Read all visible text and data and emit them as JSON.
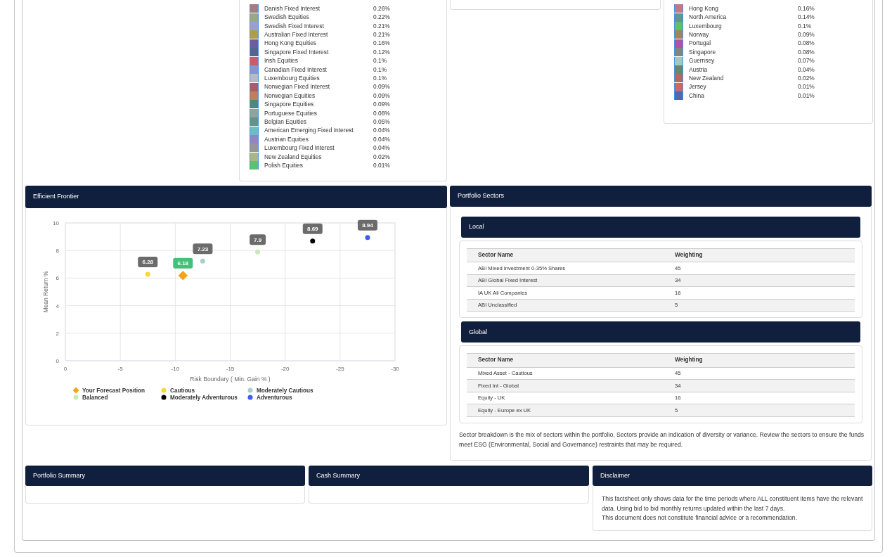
{
  "asset_classes": {
    "items": [
      {
        "name": "Danish Fixed Interest",
        "value": "0.26%",
        "color": "#a67c80"
      },
      {
        "name": "Swedish Equities",
        "value": "0.22%",
        "color": "#9aa882"
      },
      {
        "name": "Swedish Fixed Interest",
        "value": "0.21%",
        "color": "#9b9fd0"
      },
      {
        "name": "Australian Fixed Interest",
        "value": "0.21%",
        "color": "#b59a4e"
      },
      {
        "name": "Hong Kong Equities",
        "value": "0.16%",
        "color": "#6e5c9e"
      },
      {
        "name": "Singapore Fixed Interest",
        "value": "0.12%",
        "color": "#56648f"
      },
      {
        "name": "Irish Equities",
        "value": "0.1%",
        "color": "#cc5d63"
      },
      {
        "name": "Canadian Fixed Interest",
        "value": "0.1%",
        "color": "#8396cf"
      },
      {
        "name": "Luxembourg Equities",
        "value": "0.1%",
        "color": "#b6bdb8"
      },
      {
        "name": "Norwegian Fixed Interest",
        "value": "0.09%",
        "color": "#a85d6a"
      },
      {
        "name": "Norwegian Equities",
        "value": "0.09%",
        "color": "#c27d5a"
      },
      {
        "name": "Singapore Equities",
        "value": "0.09%",
        "color": "#4e8879"
      },
      {
        "name": "Portuguese Equities",
        "value": "0.08%",
        "color": "#8fa595"
      },
      {
        "name": "Belgian Equities",
        "value": "0.05%",
        "color": "#659484"
      },
      {
        "name": "American Emerging Fixed Interest",
        "value": "0.04%",
        "color": "#6cbec2"
      },
      {
        "name": "Austrian Equities",
        "value": "0.04%",
        "color": "#9683c4"
      },
      {
        "name": "Luxembourg Fixed Interest",
        "value": "0.04%",
        "color": "#9b9494"
      },
      {
        "name": "New Zealand Equities",
        "value": "0.02%",
        "color": "#a9b687"
      },
      {
        "name": "Polish Equities",
        "value": "0.01%",
        "color": "#5bc26f"
      }
    ]
  },
  "regions": {
    "items": [
      {
        "name": "Hong Kong",
        "value": "0.16%",
        "color": "#c27889"
      },
      {
        "name": "North America",
        "value": "0.14%",
        "color": "#5f9690"
      },
      {
        "name": "Luxembourg",
        "value": "0.1%",
        "color": "#63be6a"
      },
      {
        "name": "Norway",
        "value": "0.09%",
        "color": "#a0845a"
      },
      {
        "name": "Portugal",
        "value": "0.08%",
        "color": "#b052a8"
      },
      {
        "name": "Singapore",
        "value": "0.08%",
        "color": "#838480"
      },
      {
        "name": "Guernsey",
        "value": "0.07%",
        "color": "#a3c9bf"
      },
      {
        "name": "Austria",
        "value": "0.04%",
        "color": "#69876a"
      },
      {
        "name": "New Zealand",
        "value": "0.02%",
        "color": "#b06b5e"
      },
      {
        "name": "Jersey",
        "value": "0.01%",
        "color": "#cf6861"
      },
      {
        "name": "China",
        "value": "0.01%",
        "color": "#4f68b5"
      }
    ]
  },
  "efficient_frontier": {
    "title": "Efficient Frontier",
    "chart_data": {
      "type": "scatter",
      "xlabel": "Risk Boundary ( Min. Gain % )",
      "ylabel": "Mean Return %",
      "xlim": [
        0,
        -30
      ],
      "ylim": [
        0,
        10
      ],
      "xticks": [
        0,
        -5,
        -10,
        -15,
        -20,
        -25,
        -30
      ],
      "yticks": [
        0,
        2,
        4,
        6,
        8,
        10
      ],
      "data_labels": true,
      "grid": true,
      "legend": "bottom",
      "series": [
        {
          "name": "Your Forecast Position",
          "color": "#f7a21b",
          "marker": "diamond",
          "x": [
            -10.7
          ],
          "values": [
            6.18
          ]
        },
        {
          "name": "Cautious",
          "color": "#fbd83a",
          "marker": "circle",
          "x": [
            -7.5
          ],
          "values": [
            6.28
          ]
        },
        {
          "name": "Moderately Cautious",
          "color": "#a6d1c6",
          "marker": "circle",
          "x": [
            -12.5
          ],
          "values": [
            7.23
          ]
        },
        {
          "name": "Balanced",
          "color": "#c8eab4",
          "marker": "circle",
          "x": [
            -17.5
          ],
          "values": [
            7.9
          ]
        },
        {
          "name": "Moderately Adventurous",
          "color": "#000000",
          "marker": "circle",
          "x": [
            -22.5
          ],
          "values": [
            8.69
          ]
        },
        {
          "name": "Adventurous",
          "color": "#3f5cf2",
          "marker": "circle",
          "x": [
            -27.5
          ],
          "values": [
            8.94
          ]
        }
      ]
    }
  },
  "portfolio_sectors": {
    "title": "Portfolio Sectors",
    "tables": [
      {
        "title": "Local",
        "columns": [
          "Sector Name",
          "Weighting"
        ],
        "rows": [
          [
            "ABI Mixed Investment 0-35% Shares",
            "45"
          ],
          [
            "ABI Global Fixed Interest",
            "34"
          ],
          [
            "IA UK All Companies",
            "16"
          ],
          [
            "ABI Unclassified",
            "5"
          ]
        ]
      },
      {
        "title": "Global",
        "columns": [
          "Sector Name",
          "Weighting"
        ],
        "rows": [
          [
            "Mixed Asset - Cautious",
            "45"
          ],
          [
            "Fixed Int - Global",
            "34"
          ],
          [
            "Equity - UK",
            "16"
          ],
          [
            "Equity - Europe ex UK",
            "5"
          ]
        ]
      }
    ],
    "note": "Sector breakdown is the mix of sectors within the portfolio. Sectors provide an indication of diversity or variance. Review the sectors to ensure the funds meet ESG (Environmental, Social and Governance) restraints that may be required."
  },
  "portfolio_summary": {
    "title": "Portfolio Summary"
  },
  "cash_summary": {
    "title": "Cash Summary"
  },
  "disclaimer": {
    "title": "Disclaimer",
    "lines": [
      "This factsheet only shows data for the time periods where ALL constituent items have the relevant data. Using bid to bid monthly returns updated within the last 7 days.",
      "This document does not constitute financial advice or a recommendation."
    ]
  }
}
